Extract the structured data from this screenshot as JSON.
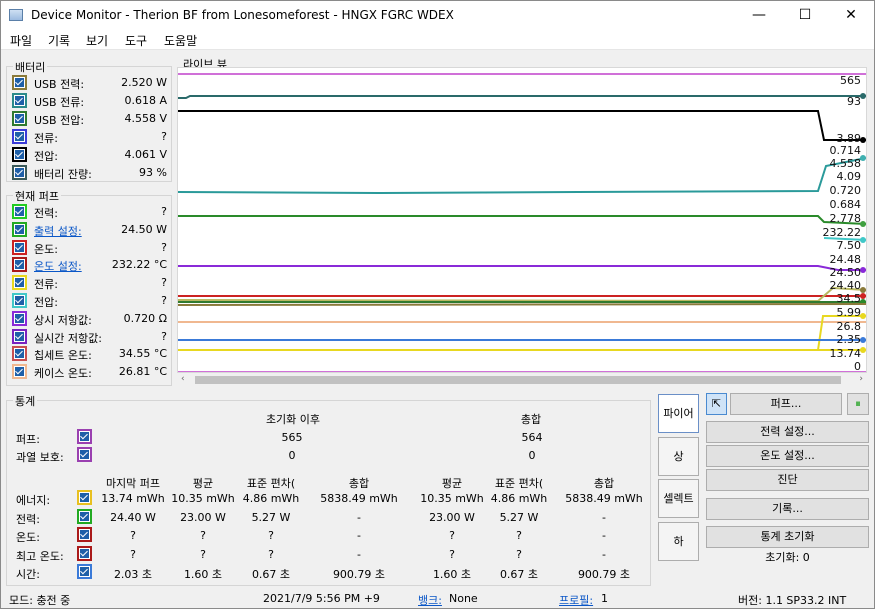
{
  "window": {
    "title": "Device Monitor - Therion BF from Lonesomeforest - HNGX FGRC WDEX",
    "minimize": "—",
    "maximize": "☐",
    "close": "✕"
  },
  "menu": [
    "파일",
    "기록",
    "보기",
    "도구",
    "도움말"
  ],
  "battery": {
    "title": "배터리",
    "rows": [
      {
        "label": "USB 전력:",
        "value": "2.520 W",
        "color": "#8a7a3a"
      },
      {
        "label": "USB 전류:",
        "value": "0.618 A",
        "color": "#2a8a8a"
      },
      {
        "label": "USB 전압:",
        "value": "4.558 V",
        "color": "#2f7a2f"
      },
      {
        "label": "전류:",
        "value": "?",
        "color": "#3b3bd8"
      },
      {
        "label": "전압:",
        "value": "4.061 V",
        "color": "#000000"
      },
      {
        "label": "배터리 잔량:",
        "value": "93 %",
        "color": "#3a5a5a"
      }
    ]
  },
  "puff": {
    "title": "현재 퍼프",
    "rows": [
      {
        "label": "전력:",
        "value": "?",
        "color": "#22cc22",
        "link": false
      },
      {
        "label": "출력 설정:",
        "value": "24.50 W",
        "color": "#22aa22",
        "link": true
      },
      {
        "label": "온도:",
        "value": "?",
        "color": "#cc2222",
        "link": false
      },
      {
        "label": "온도 설정:",
        "value": "232.22 °C",
        "color": "#aa1a1a",
        "link": true
      },
      {
        "label": "전류:",
        "value": "?",
        "color": "#e8d820",
        "link": false
      },
      {
        "label": "전압:",
        "value": "?",
        "color": "#40c8c8",
        "link": false
      },
      {
        "label": "상시 저항값:",
        "value": "0.720 Ω",
        "color": "#8a2ad8",
        "link": false
      },
      {
        "label": "실시간 저항값:",
        "value": "?",
        "color": "#7a22c0",
        "link": false
      },
      {
        "label": "칩세트 온도:",
        "value": "34.55 °C",
        "color": "#c85050",
        "link": false
      },
      {
        "label": "케이스 온도:",
        "value": "26.81 °C",
        "color": "#f0b890",
        "link": false
      }
    ]
  },
  "live": {
    "title": "라이브 뷰",
    "labels": [
      "565",
      "93",
      "3.89",
      "0.714",
      "4.558",
      "4.09",
      "0.720",
      "0.684",
      "2.778",
      "232.22",
      "7.50",
      "24.48",
      "24.50",
      "24.40",
      "34.5",
      "5.99",
      "26.8",
      "2.35",
      "13.74",
      "0"
    ],
    "scroll_left": "‹",
    "scroll_right": "›"
  },
  "stats": {
    "title": "통계",
    "since_reset": "초기화 이후",
    "total": "총합",
    "top_rows": [
      {
        "label": "퍼프:",
        "color": "#9a40b0",
        "since": "565",
        "total": "564"
      },
      {
        "label": "과열 보호:",
        "color": "#9a40b0",
        "since": "0",
        "total": "0"
      }
    ],
    "headers": [
      "마지막 퍼프",
      "평균",
      "표준 편차(",
      "총합",
      "평균",
      "표준 편차(",
      "총합"
    ],
    "rows": [
      {
        "label": "에너지:",
        "color": "#e8c020",
        "cells": [
          "13.74 mWh",
          "10.35 mWh",
          "4.86 mWh",
          "5838.49 mWh",
          "10.35 mWh",
          "4.86 mWh",
          "5838.49 mWh"
        ]
      },
      {
        "label": "전력:",
        "color": "#22aa22",
        "cells": [
          "24.40 W",
          "23.00 W",
          "5.27 W",
          "-",
          "23.00 W",
          "5.27 W",
          "-"
        ]
      },
      {
        "label": "온도:",
        "color": "#aa1a1a",
        "cells": [
          "?",
          "?",
          "?",
          "-",
          "?",
          "?",
          "-"
        ]
      },
      {
        "label": "최고 온도:",
        "color": "#aa1a1a",
        "cells": [
          "?",
          "?",
          "?",
          "-",
          "?",
          "?",
          "-"
        ]
      },
      {
        "label": "시간:",
        "color": "#3a7ad8",
        "cells": [
          "2.03 초",
          "1.60 초",
          "0.67 초",
          "900.79 초",
          "1.60 초",
          "0.67 초",
          "900.79 초"
        ]
      }
    ]
  },
  "tabs": [
    "파이어",
    "상",
    "셀렉트",
    "하"
  ],
  "buttons": {
    "cursor": "⇱",
    "puff": "퍼프...",
    "pause": "⏸",
    "power_settings": "전력 설정...",
    "temp_settings": "온도 설정...",
    "diagnose": "진단",
    "log": "기록...",
    "stats_reset": "통계 초기화",
    "reset_count": "초기화: 0"
  },
  "status": {
    "mode": "모드: 충전 중",
    "datetime": "2021/7/9 5:56 PM +9",
    "bank_label": "뱅크:",
    "bank_value": "None",
    "profile_label": "프로필:",
    "profile_value": "1",
    "version": "버전: 1.1 SP33.2 INT"
  }
}
